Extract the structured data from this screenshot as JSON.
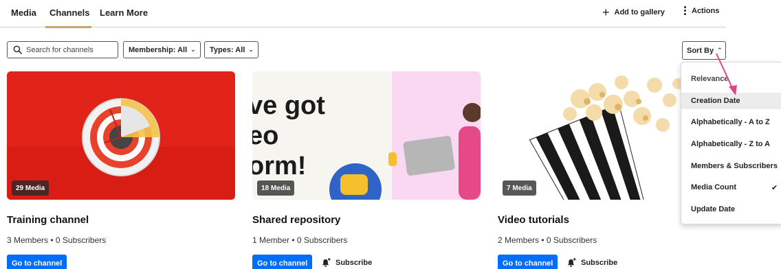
{
  "nav": {
    "tabs": [
      {
        "label": "Media"
      },
      {
        "label": "Channels"
      },
      {
        "label": "Learn More"
      }
    ],
    "add_to_gallery": "Add to gallery",
    "actions": "Actions"
  },
  "filters": {
    "search_placeholder": "Search for channels",
    "membership": "Membership: All",
    "types": "Types: All"
  },
  "sort": {
    "label": "Sort By",
    "options": [
      {
        "label": "Relevance"
      },
      {
        "label": "Creation Date"
      },
      {
        "label": "Alphabetically - A to Z"
      },
      {
        "label": "Alphabetically - Z to A"
      },
      {
        "label": "Members & Subscribers"
      },
      {
        "label": "Media Count",
        "selected": true
      },
      {
        "label": "Update Date"
      }
    ],
    "hovered": "Creation Date"
  },
  "channels": [
    {
      "badge": "29 Media",
      "title": "Training channel",
      "meta": "3 Members • 0 Subscribers",
      "go_label": "Go to channel",
      "subscribe_label": ""
    },
    {
      "badge": "18 Media",
      "title": "Shared repository",
      "meta": "1 Member • 0 Subscribers",
      "go_label": "Go to channel",
      "subscribe_label": "Subscribe",
      "thumb_text": [
        "ve got",
        "eo",
        "orm!"
      ]
    },
    {
      "badge": "7 Media",
      "title": "Video tutorials",
      "meta": "2 Members • 0 Subscribers",
      "go_label": "Go to channel",
      "subscribe_label": "Subscribe"
    }
  ],
  "icons": {
    "search": "search-icon",
    "add": "plus-icon",
    "actions": "vertical-dots-icon",
    "chevron": "chevron-down-icon",
    "subscribe": "bell-plus-icon",
    "check": "checkmark-icon"
  },
  "colors": {
    "primary_button": "#006efa",
    "tab_underline": "#c9a56a",
    "annotation_arrow": "#e0458c",
    "card1_bg": "#e2231a"
  }
}
